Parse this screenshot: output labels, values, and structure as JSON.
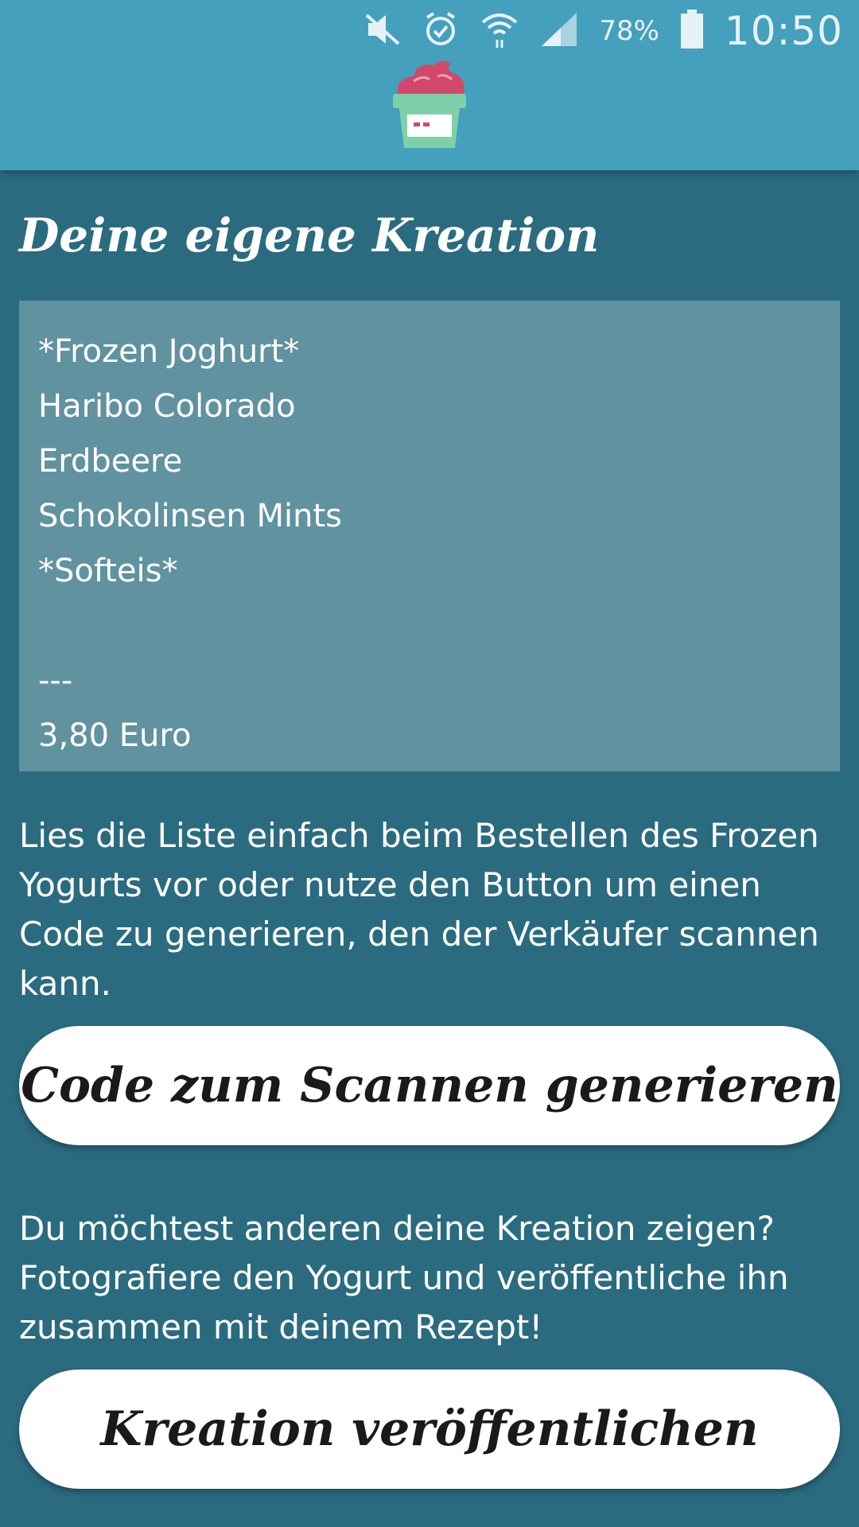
{
  "status_bar": {
    "icons": [
      "mute-icon",
      "alarm-icon",
      "wifi-icon",
      "signal-icon",
      "battery-icon"
    ],
    "battery_percent": "78%",
    "time": "10:50"
  },
  "header": {
    "logo_icon": "frozen-yogurt-cup-icon"
  },
  "page": {
    "title": "Deine eigene Kreation"
  },
  "recipe": {
    "lines": [
      "*Frozen Joghurt*",
      "Haribo Colorado",
      "Erdbeere",
      "Schokolinsen Mints",
      "*Softeis*",
      "",
      "---",
      "3,80 Euro"
    ]
  },
  "info": {
    "order_hint": "Lies die Liste einfach beim Bestellen des Frozen Yogurts vor oder nutze den Button um einen Code zu generieren, den der Verkäufer scannen kann.",
    "share_hint": "Du möchtest anderen deine Kreation zeigen? Fotografiere den Yogurt und veröffentliche ihn zusammen mit deinem Rezept!"
  },
  "buttons": {
    "generate_code_label": "Code zum Scannen generieren",
    "publish_label": "Kreation veröffentlichen"
  },
  "colors": {
    "header_bg": "#44a0bd",
    "page_bg": "#2b6b7f",
    "recipe_box_bg": "#6192a0",
    "button_bg": "#ffffff"
  }
}
